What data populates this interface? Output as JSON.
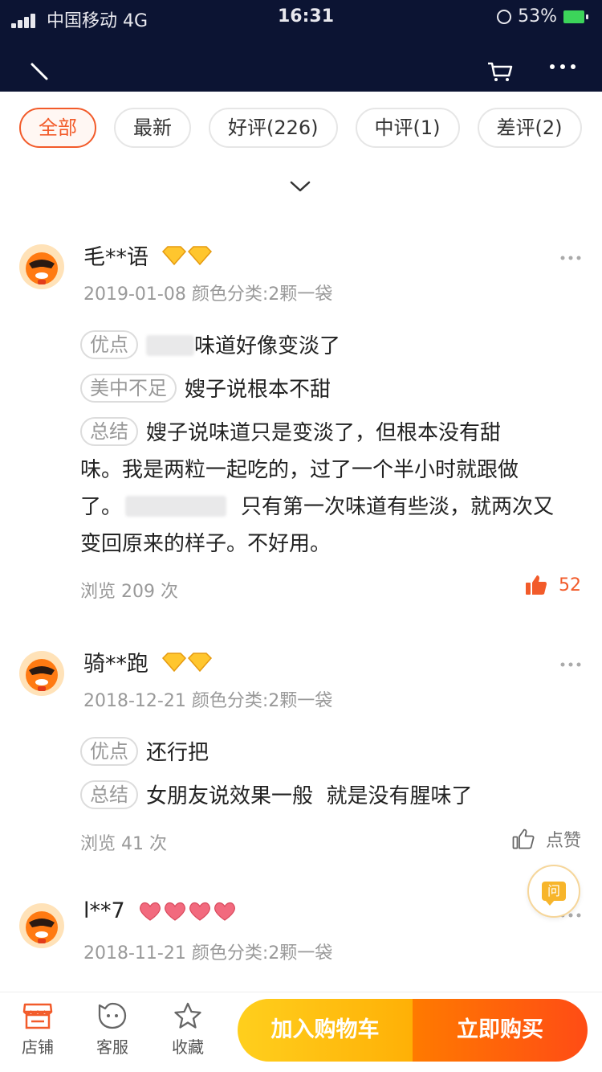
{
  "status_bar": {
    "carrier": "中国移动 4G",
    "time": "16:31",
    "battery": "53%"
  },
  "filters": [
    {
      "label": "全部",
      "active": true
    },
    {
      "label": "最新",
      "active": false
    },
    {
      "label": "好评(226)",
      "active": false
    },
    {
      "label": "中评(1)",
      "active": false
    },
    {
      "label": "差评(2)",
      "active": false
    }
  ],
  "reviews": [
    {
      "user": "毛**语",
      "badge_type": "diamond",
      "badge_count": 2,
      "date": "2019-01-08",
      "variant": "颜色分类:2颗一袋",
      "pros_tag": "优点",
      "pros_text": "味道好像变淡了",
      "cons_tag": "美中不足",
      "cons_text": "嫂子说根本不甜",
      "summary_tag": "总结",
      "summary_lines": [
        "嫂子说味道只是变淡了，但根本没有甜",
        "味。我是两粒一起吃的，过了一个半小时就跟做",
        "只有第一次味道有些淡，就两次又",
        "变回原来的样子。不好用。"
      ],
      "summary_line3_prefix": "了。",
      "views": "浏览 209 次",
      "likes": "52"
    },
    {
      "user": "骑**跑",
      "badge_type": "diamond",
      "badge_count": 2,
      "date": "2018-12-21",
      "variant": "颜色分类:2颗一袋",
      "pros_tag": "优点",
      "pros_text": "还行把",
      "summary_tag": "总结",
      "summary_text": "女朋友说效果一般  就是没有腥味了",
      "views": "浏览 41 次",
      "likes": "点赞"
    },
    {
      "user": "l**7",
      "badge_type": "heart",
      "badge_count": 4,
      "date": "2018-11-21",
      "variant": "颜色分类:2颗一袋"
    }
  ],
  "ask_button": "问",
  "bottom_bar": {
    "shop": "店铺",
    "service": "客服",
    "favorite": "收藏",
    "add_to_cart": "加入购物车",
    "buy_now": "立即购买"
  },
  "colors": {
    "accent": "#f25b2a",
    "topbar": "#0c1433",
    "cart_button": "#ffb006",
    "buy_button": "#ff4c15"
  }
}
